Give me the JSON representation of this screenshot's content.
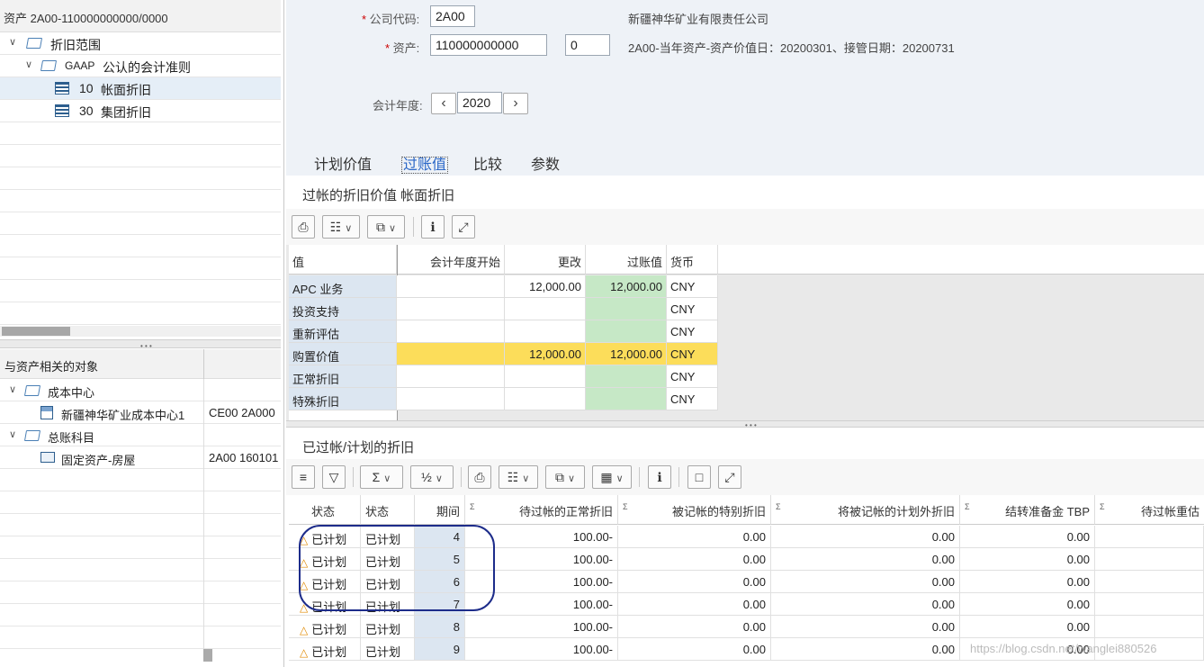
{
  "left": {
    "header": "资产 2A00-110000000000/0000",
    "tree": [
      {
        "label": "折旧范围",
        "prefix": ""
      },
      {
        "label": "公认的会计准则",
        "prefix": "GAAP"
      },
      {
        "label": "帐面折旧",
        "prefix": "10"
      },
      {
        "label": "集团折旧",
        "prefix": "30"
      }
    ],
    "objects_header": "与资产相关的对象",
    "objects": [
      {
        "label": "成本中心",
        "value": ""
      },
      {
        "label": "新疆神华矿业成本中心1",
        "value": "CE00 2A000"
      },
      {
        "label": "总账科目",
        "value": ""
      },
      {
        "label": "固定资产-房屋",
        "value": "2A00 160101"
      }
    ]
  },
  "header": {
    "company_code_label": "公司代码:",
    "company_code_value": "2A00",
    "company_name": "新疆神华矿业有限责任公司",
    "asset_label": "资产:",
    "asset_value": "110000000000",
    "asset_sub_value": "0",
    "asset_info": "2A00-当年资产-资产价值日：20200301、接管日期：20200731",
    "fiscal_year_label": "会计年度:",
    "fiscal_year_value": "2020"
  },
  "tabs": [
    "计划价值",
    "过账值",
    "比较",
    "参数"
  ],
  "panel1": {
    "title": "过帐的折旧价值 帐面折旧",
    "columns": [
      "值",
      "会计年度开始",
      "更改",
      "过账值",
      "货币"
    ],
    "rows": [
      {
        "name": "APC 业务",
        "start": "",
        "change": "12,000.00",
        "posted": "12,000.00",
        "currency": "CNY"
      },
      {
        "name": "投资支持",
        "start": "",
        "change": "",
        "posted": "",
        "currency": "CNY"
      },
      {
        "name": "重新评估",
        "start": "",
        "change": "",
        "posted": "",
        "currency": "CNY"
      },
      {
        "name": "购置价值",
        "start": "",
        "change": "12,000.00",
        "posted": "12,000.00",
        "currency": "CNY"
      },
      {
        "name": "正常折旧",
        "start": "",
        "change": "",
        "posted": "",
        "currency": "CNY"
      },
      {
        "name": "特殊折旧",
        "start": "",
        "change": "",
        "posted": "",
        "currency": "CNY"
      }
    ]
  },
  "panel2": {
    "title": "已过帐/计划的折旧",
    "columns": [
      "状态",
      "状态",
      "期间",
      "待过帐的正常折旧",
      "被记帐的特别折旧",
      "将被记帐的计划外折旧",
      "结转准备金 TBP",
      "待过帐重估"
    ],
    "rows": [
      {
        "s1": "已计划",
        "s2": "已计划",
        "period": "4",
        "normal": "100.00-",
        "special": "0.00",
        "unplanned": "0.00",
        "tbp": "0.00"
      },
      {
        "s1": "已计划",
        "s2": "已计划",
        "period": "5",
        "normal": "100.00-",
        "special": "0.00",
        "unplanned": "0.00",
        "tbp": "0.00"
      },
      {
        "s1": "已计划",
        "s2": "已计划",
        "period": "6",
        "normal": "100.00-",
        "special": "0.00",
        "unplanned": "0.00",
        "tbp": "0.00"
      },
      {
        "s1": "已计划",
        "s2": "已计划",
        "period": "7",
        "normal": "100.00-",
        "special": "0.00",
        "unplanned": "0.00",
        "tbp": "0.00"
      },
      {
        "s1": "已计划",
        "s2": "已计划",
        "period": "8",
        "normal": "100.00-",
        "special": "0.00",
        "unplanned": "0.00",
        "tbp": "0.00"
      },
      {
        "s1": "已计划",
        "s2": "已计划",
        "period": "9",
        "normal": "100.00-",
        "special": "0.00",
        "unplanned": "0.00",
        "tbp": "0.00"
      }
    ]
  },
  "watermark": "https://blog.csdn.net/wanglei880526",
  "colors": {
    "posted_green": "#c6e8c6",
    "highlight_yellow": "#fcdd5a",
    "accent": "#2a67c7"
  }
}
